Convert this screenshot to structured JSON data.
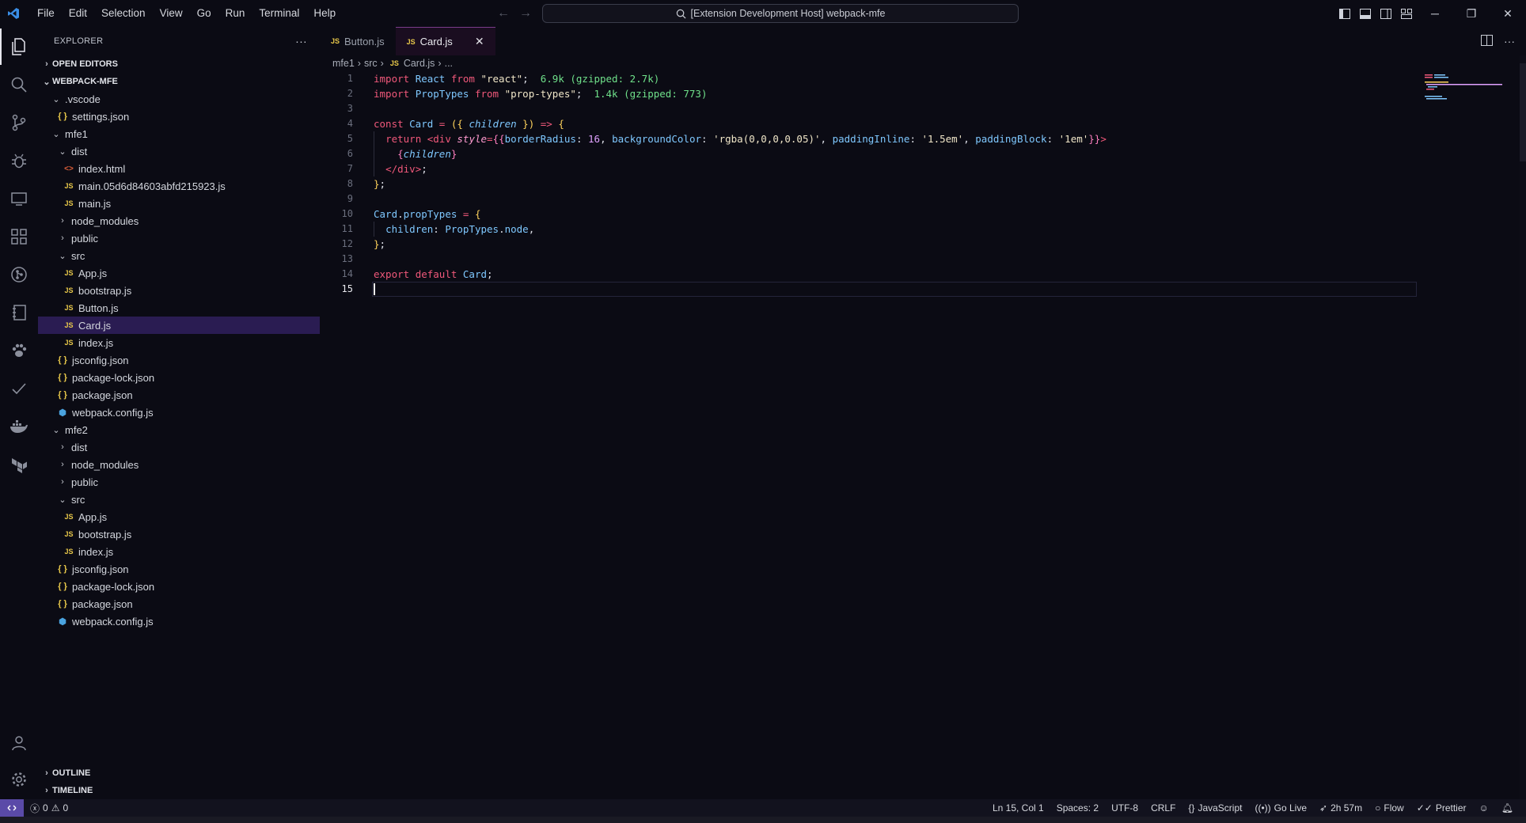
{
  "titlebar": {
    "menu": [
      "File",
      "Edit",
      "Selection",
      "View",
      "Go",
      "Run",
      "Terminal",
      "Help"
    ],
    "search_text": "[Extension Development Host] webpack-mfe"
  },
  "sidebar": {
    "title": "EXPLORER",
    "open_editors": "OPEN EDITORS",
    "workspace": "WEBPACK-MFE",
    "tree": [
      {
        "label": ".vscode",
        "type": "folder",
        "depth": 1,
        "open": true
      },
      {
        "label": "settings.json",
        "type": "json",
        "depth": 2
      },
      {
        "label": "mfe1",
        "type": "folder",
        "depth": 1,
        "open": true
      },
      {
        "label": "dist",
        "type": "folder",
        "depth": 2,
        "open": true
      },
      {
        "label": "index.html",
        "type": "html",
        "depth": 3
      },
      {
        "label": "main.05d6d84603abfd215923.js",
        "type": "js",
        "depth": 3
      },
      {
        "label": "main.js",
        "type": "js",
        "depth": 3
      },
      {
        "label": "node_modules",
        "type": "folder",
        "depth": 2,
        "open": false
      },
      {
        "label": "public",
        "type": "folder",
        "depth": 2,
        "open": false
      },
      {
        "label": "src",
        "type": "folder",
        "depth": 2,
        "open": true
      },
      {
        "label": "App.js",
        "type": "js",
        "depth": 3
      },
      {
        "label": "bootstrap.js",
        "type": "js",
        "depth": 3
      },
      {
        "label": "Button.js",
        "type": "js",
        "depth": 3
      },
      {
        "label": "Card.js",
        "type": "js",
        "depth": 3,
        "selected": true
      },
      {
        "label": "index.js",
        "type": "js",
        "depth": 3
      },
      {
        "label": "jsconfig.json",
        "type": "json",
        "depth": 2
      },
      {
        "label": "package-lock.json",
        "type": "json",
        "depth": 2
      },
      {
        "label": "package.json",
        "type": "json",
        "depth": 2
      },
      {
        "label": "webpack.config.js",
        "type": "webpack",
        "depth": 2
      },
      {
        "label": "mfe2",
        "type": "folder",
        "depth": 1,
        "open": true
      },
      {
        "label": "dist",
        "type": "folder",
        "depth": 2,
        "open": false
      },
      {
        "label": "node_modules",
        "type": "folder",
        "depth": 2,
        "open": false
      },
      {
        "label": "public",
        "type": "folder",
        "depth": 2,
        "open": false
      },
      {
        "label": "src",
        "type": "folder",
        "depth": 2,
        "open": true
      },
      {
        "label": "App.js",
        "type": "js",
        "depth": 3
      },
      {
        "label": "bootstrap.js",
        "type": "js",
        "depth": 3
      },
      {
        "label": "index.js",
        "type": "js",
        "depth": 3
      },
      {
        "label": "jsconfig.json",
        "type": "json",
        "depth": 2
      },
      {
        "label": "package-lock.json",
        "type": "json",
        "depth": 2
      },
      {
        "label": "package.json",
        "type": "json",
        "depth": 2
      },
      {
        "label": "webpack.config.js",
        "type": "webpack",
        "depth": 2
      }
    ],
    "outline": "OUTLINE",
    "timeline": "TIMELINE"
  },
  "editor": {
    "tabs": [
      {
        "label": "Button.js",
        "active": false
      },
      {
        "label": "Card.js",
        "active": true
      }
    ],
    "breadcrumb": [
      "mfe1",
      "src",
      "Card.js",
      "..."
    ],
    "current_line": 15,
    "lines": [
      [
        {
          "c": "k",
          "t": "import "
        },
        {
          "c": "v",
          "t": "React "
        },
        {
          "c": "k",
          "t": "from "
        },
        {
          "c": "s",
          "t": "\"react\""
        },
        {
          "c": "",
          "t": ";  "
        },
        {
          "c": "sz",
          "t": "6.9k (gzipped: 2.7k)"
        }
      ],
      [
        {
          "c": "k",
          "t": "import "
        },
        {
          "c": "v",
          "t": "PropTypes "
        },
        {
          "c": "k",
          "t": "from "
        },
        {
          "c": "s",
          "t": "\"prop-types\""
        },
        {
          "c": "",
          "t": ";  "
        },
        {
          "c": "sz",
          "t": "1.4k (gzipped: 773)"
        }
      ],
      [],
      [
        {
          "c": "k",
          "t": "const "
        },
        {
          "c": "v",
          "t": "Card "
        },
        {
          "c": "k",
          "t": "= "
        },
        {
          "c": "p",
          "t": "({ "
        },
        {
          "c": "pi",
          "t": "children"
        },
        {
          "c": "p",
          "t": " })"
        },
        {
          "c": "k",
          "t": " => "
        },
        {
          "c": "p",
          "t": "{"
        }
      ],
      [
        {
          "c": "",
          "t": "  "
        },
        {
          "c": "k",
          "t": "return "
        },
        {
          "c": "t",
          "t": "<div "
        },
        {
          "c": "a",
          "t": "style"
        },
        {
          "c": "k",
          "t": "="
        },
        {
          "c": "pp",
          "t": "{{"
        },
        {
          "c": "v",
          "t": "borderRadius"
        },
        {
          "c": "",
          "t": ": "
        },
        {
          "c": "n",
          "t": "16"
        },
        {
          "c": "",
          "t": ", "
        },
        {
          "c": "v",
          "t": "backgroundColor"
        },
        {
          "c": "",
          "t": ": "
        },
        {
          "c": "s",
          "t": "'rgba(0,0,0,0.05)'"
        },
        {
          "c": "",
          "t": ", "
        },
        {
          "c": "v",
          "t": "paddingInline"
        },
        {
          "c": "",
          "t": ": "
        },
        {
          "c": "s",
          "t": "'1.5em'"
        },
        {
          "c": "",
          "t": ", "
        },
        {
          "c": "v",
          "t": "paddingBlock"
        },
        {
          "c": "",
          "t": ": "
        },
        {
          "c": "s",
          "t": "'1em'"
        },
        {
          "c": "pp",
          "t": "}}"
        },
        {
          "c": "t",
          "t": ">"
        }
      ],
      [
        {
          "c": "",
          "t": "    "
        },
        {
          "c": "pp",
          "t": "{"
        },
        {
          "c": "pi",
          "t": "children"
        },
        {
          "c": "pp",
          "t": "}"
        }
      ],
      [
        {
          "c": "",
          "t": "  "
        },
        {
          "c": "t",
          "t": "</div>"
        },
        {
          "c": "",
          "t": ";"
        }
      ],
      [
        {
          "c": "p",
          "t": "}"
        },
        {
          "c": "",
          "t": ";"
        }
      ],
      [],
      [
        {
          "c": "v",
          "t": "Card"
        },
        {
          "c": "",
          "t": "."
        },
        {
          "c": "v",
          "t": "propTypes "
        },
        {
          "c": "k",
          "t": "= "
        },
        {
          "c": "p",
          "t": "{"
        }
      ],
      [
        {
          "c": "",
          "t": "  "
        },
        {
          "c": "v",
          "t": "children"
        },
        {
          "c": "",
          "t": ": "
        },
        {
          "c": "v",
          "t": "PropTypes"
        },
        {
          "c": "",
          "t": "."
        },
        {
          "c": "v",
          "t": "node"
        },
        {
          "c": "",
          "t": ","
        }
      ],
      [
        {
          "c": "p",
          "t": "}"
        },
        {
          "c": "",
          "t": ";"
        }
      ],
      [],
      [
        {
          "c": "k",
          "t": "export "
        },
        {
          "c": "k",
          "t": "default "
        },
        {
          "c": "v",
          "t": "Card"
        },
        {
          "c": "",
          "t": ";"
        }
      ],
      []
    ]
  },
  "statusbar": {
    "errors": "0",
    "warnings": "0",
    "position": "Ln 15, Col 1",
    "spaces": "Spaces: 2",
    "encoding": "UTF-8",
    "eol": "CRLF",
    "language": "JavaScript",
    "golive": "Go Live",
    "time": "2h 57m",
    "flow": "Flow",
    "prettier": "Prettier"
  },
  "colors": {
    "accent": "#5a4aa8",
    "selection": "#2a1c52",
    "keyword": "#f0587a",
    "variable": "#7fc8ff"
  }
}
